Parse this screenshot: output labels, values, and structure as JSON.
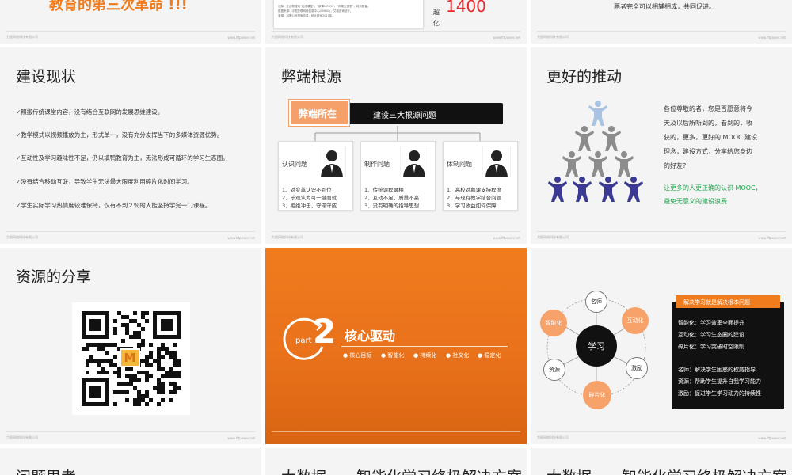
{
  "footer": {
    "left": "力图网络科技有限公司",
    "right": "www.lftpower.net"
  },
  "top_row": {
    "s1_text": "教育的第三次革命 !!!",
    "s2_lines": [
      "注释：在谷歌搜索“在线课程”，“慕课MOOC”，“网易云课堂”，网页数量。",
      "数据来源：中国互联网络信息中心(CNNIC)，艾瑞咨询统计。",
      "来源：谷歌公司搜索结果，统计时间2017年。"
    ],
    "s2_big_number": "1400",
    "s2_unit_1": "超",
    "s2_unit_2": "亿",
    "s3_text": "两者完全可以相辅相成，共同促进。"
  },
  "s4": {
    "title": "建设现状",
    "bullets": [
      "✓照搬传统课堂内容，没有结合互联网的发展思维建设。",
      "✓教学模式以视频播放为主，形式单一，没有充分发挥当下的多媒体资源优势。",
      "✓互动性及学习趣味性不足，仍以填鸭教育为主，无法形成可循环的学习生态圈。",
      "✓没有结合移动互联，导致学生无法最大限度利用碎片化时间学习。",
      "✓学生实际学习热情度较难保持，仅有不到２％的人能坚持学完一门课程。"
    ]
  },
  "s5": {
    "title": "弊端根源",
    "tag": "弊端所在",
    "header": "建设三大根源问题",
    "cards": [
      {
        "label": "认识问题",
        "lines": [
          "1、对变革认识不到位",
          "2、乐观认为可一蹴而就",
          "3、拒绝冲击，守滞守成"
        ]
      },
      {
        "label": "制作问题",
        "lines": [
          "1、传统课程录相",
          "2、互动不足，质量不高",
          "3、没有明确的指导思想"
        ]
      },
      {
        "label": "体制问题",
        "lines": [
          "1、高校对慕课支持程度",
          "2、与现有教学结合问题",
          "3、学习收益如何保障"
        ]
      }
    ]
  },
  "s6": {
    "title": "更好的推动",
    "para": [
      "各位尊敬的者，您是否愿意将今",
      "天及以后所听到的，看到的，收",
      "获的，更多，更好的 MOOC 建设",
      "理念，建设方式，分享给您身边",
      "的好友?"
    ],
    "green": [
      "让更多的人更正确的认识 MOOC，",
      "避免无意义的建设浪费"
    ],
    "colors": {
      "top": "#a9c4e2",
      "middle": "#8c8c8c",
      "bottom": "#3b3a92"
    }
  },
  "s7": {
    "title": "资源的分享",
    "qr_logo": "M"
  },
  "s8": {
    "part_word": "part",
    "part_num": "2",
    "title": "核心驱动",
    "items": [
      "● 核心目标",
      "● 智能化",
      "● 持续化",
      "● 社交化",
      "● 稳定化"
    ]
  },
  "s9": {
    "center": "学习",
    "nodes": {
      "top": "名师",
      "tr": "互动化",
      "r": "激励",
      "b": "碎片化",
      "l": "资源",
      "tl": "智能化"
    },
    "panel_title": "解决学习就是解决根本问题",
    "panel_lines": [
      "智能化：学习效率全面提升",
      "互动化：学习生态圈的建设",
      "碎片化：学习突破时空限制",
      "",
      "名师：解决学生困惑的权威指导",
      "资源：帮助学生提升自我学习能力",
      "激励：促进学生学习动力的持续性"
    ]
  },
  "bottom_row": {
    "b1": "问题思考",
    "b2": "大数据——智能化学习终极解决方案",
    "b3": "大数据——智能化学习终极解决方案"
  }
}
